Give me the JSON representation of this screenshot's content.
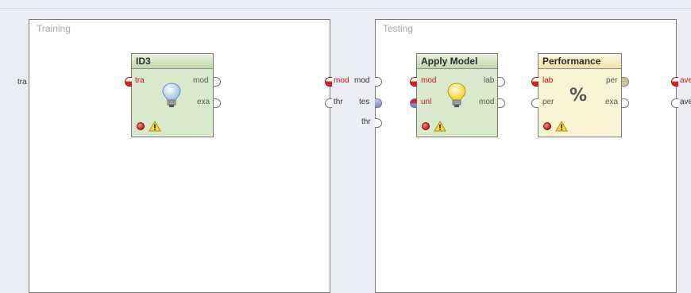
{
  "training": {
    "title": "Training",
    "left_port": "tra",
    "right_ports": [
      "mod"
    ],
    "right_ports_out": [
      "thr"
    ]
  },
  "testing": {
    "title": "Testing",
    "left_ports": [
      "mod",
      "tes",
      "thr"
    ],
    "right_ports": [
      "ave",
      "ave"
    ]
  },
  "operators": {
    "id3": {
      "title": "ID3",
      "inputs": [
        "tra"
      ],
      "outputs": [
        "mod",
        "exa"
      ],
      "icon": "lightbulb-icon"
    },
    "apply_model": {
      "title": "Apply Model",
      "inputs": [
        "mod",
        "unl"
      ],
      "outputs": [
        "lab",
        "mod"
      ],
      "icon": "lightbulb-icon"
    },
    "performance": {
      "title": "Performance",
      "inputs": [
        "lab",
        "per"
      ],
      "outputs": [
        "per",
        "exa"
      ],
      "icon": "percent-icon",
      "icon_text": "%"
    }
  },
  "colors": {
    "operator_green": "#d9e9cc",
    "operator_yellow": "#f9f4d4",
    "port_red": "#d92020",
    "port_blue": "#7f84c6"
  }
}
